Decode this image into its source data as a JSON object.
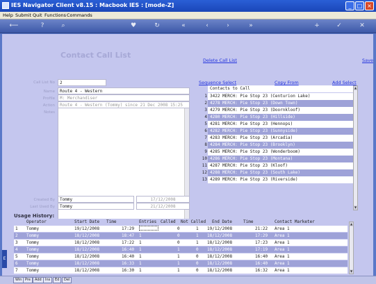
{
  "window": {
    "title": "IES Navigator Client v8.15 : Macbook IES :       [mode-Z]"
  },
  "menu": [
    "Help",
    "Submit",
    "Quit",
    "Functions",
    "Commands"
  ],
  "page": {
    "heading": "Contact Call List",
    "delete_link": "Delete Call List",
    "save_link": "Save",
    "sequence_link": "Sequence Select",
    "copyfrom_link": "Copy From",
    "addselect_link": "Add Select"
  },
  "form": {
    "call_list_no_label": "Call List No",
    "call_list_no": "2",
    "name_label": "Name",
    "name": "Route 4 - Western",
    "profile_label": "Profile",
    "profile": "M: Merchandiser",
    "action_label": "Action",
    "action": "Route 4 - Western (Tommy) since 21 Dec 2008 15:25",
    "notes_label": "Notes",
    "created_by_label": "Created By",
    "created_by": "Tommy",
    "created_date": "17/12/2008",
    "last_used_label": "Last Used By",
    "last_used_by": "Tommy",
    "last_used_date": "21/12/2008"
  },
  "contacts": {
    "header": "Contacts to Call",
    "rows": [
      {
        "n": "1",
        "t": "3422 MERCH: Pie Stop 23 (Centurion Lake)"
      },
      {
        "n": "2",
        "t": "4278 MERCH: Pie Stop 23 (Down Town)"
      },
      {
        "n": "3",
        "t": "4279 MERCH: Pie Stop 23 (Doornkloof)"
      },
      {
        "n": "4",
        "t": "4280 MERCH: Pie Stop 23 (Hillside)"
      },
      {
        "n": "5",
        "t": "4281 MERCH: Pie Stop 23 (Hennops)"
      },
      {
        "n": "6",
        "t": "4282 MERCH: Pie Stop 23 (Sunnyside)"
      },
      {
        "n": "7",
        "t": "4283 MERCH: Pie Stop 23 (Arcadia)"
      },
      {
        "n": "8",
        "t": "4284 MERCH: Pie Stop 23 (Brooklyn)"
      },
      {
        "n": "9",
        "t": "4285 MERCH: Pie Stop 23 (Wonderboom)"
      },
      {
        "n": "10",
        "t": "4286 MERCH: Pie Stop 23 (Montana)"
      },
      {
        "n": "11",
        "t": "4287 MERCH: Pie Stop 23 (Kloof)"
      },
      {
        "n": "12",
        "t": "4288 MERCH: Pie Stop 23 (South Lake)"
      },
      {
        "n": "13",
        "t": "4289 MERCH: Pie Stop 23 (Riverside)"
      }
    ]
  },
  "usage": {
    "title": "Usage History:",
    "columns": [
      "Operator",
      "Start Date",
      "Time",
      "Entries",
      "Called",
      "Not Called",
      "End Date",
      "Time",
      "Contact Marketer"
    ],
    "rows": [
      {
        "n": "1",
        "op": "Tommy",
        "sd": "19/12/2008",
        "st": "17:29",
        "en": "",
        "ca": "0",
        "nc": "1",
        "ed": "19/12/2008",
        "et": "21:22",
        "cm": "Area 1"
      },
      {
        "n": "2",
        "op": "Tommy",
        "sd": "18/12/2008",
        "st": "18:47",
        "en": "1",
        "ca": "0",
        "nc": "1",
        "ed": "18/12/2008",
        "et": "17:29",
        "cm": "Area 1"
      },
      {
        "n": "3",
        "op": "Tommy",
        "sd": "18/12/2008",
        "st": "17:22",
        "en": "1",
        "ca": "0",
        "nc": "1",
        "ed": "18/12/2008",
        "et": "17:23",
        "cm": "Area 1"
      },
      {
        "n": "4",
        "op": "Tommy",
        "sd": "18/12/2008",
        "st": "16:40",
        "en": "1",
        "ca": "1",
        "nc": "0",
        "ed": "18/12/2008",
        "et": "17:19",
        "cm": "Area 1"
      },
      {
        "n": "5",
        "op": "Tommy",
        "sd": "18/12/2008",
        "st": "16:40",
        "en": "1",
        "ca": "1",
        "nc": "0",
        "ed": "18/12/2008",
        "et": "16:40",
        "cm": "Area 1"
      },
      {
        "n": "6",
        "op": "Tommy",
        "sd": "18/12/2008",
        "st": "16:33",
        "en": "1",
        "ca": "1",
        "nc": "0",
        "ed": "18/12/2008",
        "et": "16:40",
        "cm": "Area 1"
      },
      {
        "n": "7",
        "op": "Tommy",
        "sd": "18/12/2008",
        "st": "16:30",
        "en": "1",
        "ca": "1",
        "nc": "0",
        "ed": "18/12/2008",
        "et": "16:32",
        "cm": "Area 1"
      }
    ]
  },
  "statusbar": [
    "Win",
    "Pre",
    "Add",
    "Ins",
    "Ed",
    "Del"
  ]
}
